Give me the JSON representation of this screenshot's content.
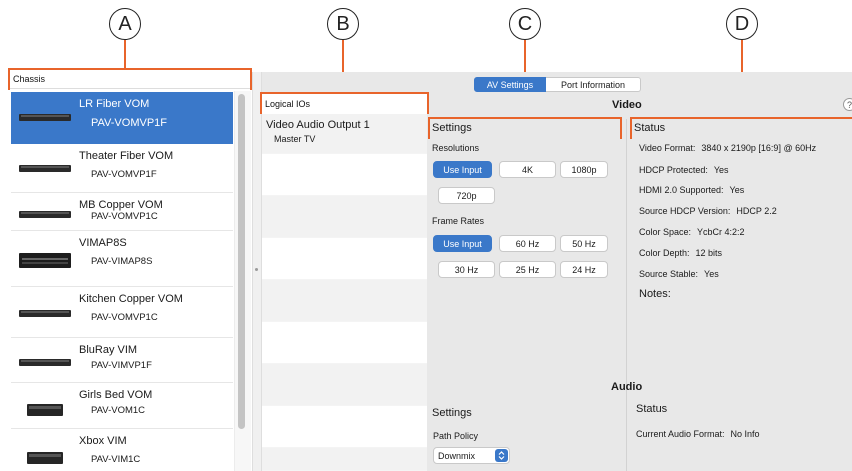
{
  "callouts": [
    "A",
    "B",
    "C",
    "D"
  ],
  "chassis": {
    "header": "Chassis",
    "items": [
      {
        "name": "LR Fiber VOM",
        "model": "PAV-VOMVP1F",
        "selected": true
      },
      {
        "name": "Theater Fiber VOM",
        "model": "PAV-VOMVP1F",
        "selected": false
      },
      {
        "name": "MB Copper VOM",
        "model": "PAV-VOMVP1C",
        "selected": false
      },
      {
        "name": "VIMAP8S",
        "model": "PAV-VIMAP8S",
        "selected": false
      },
      {
        "name": "Kitchen Copper VOM",
        "model": "PAV-VOMVP1C",
        "selected": false
      },
      {
        "name": "BluRay VIM",
        "model": "PAV-VIMVP1F",
        "selected": false
      },
      {
        "name": "Girls Bed VOM",
        "model": "PAV-VOM1C",
        "selected": false
      },
      {
        "name": "Xbox VIM",
        "model": "PAV-VIM1C",
        "selected": false
      }
    ]
  },
  "logical_ios": {
    "header": "Logical IOs",
    "items": [
      {
        "title": "Video Audio Output 1",
        "subtitle": "Master TV"
      }
    ]
  },
  "tabs": [
    {
      "label": "AV Settings",
      "active": true
    },
    {
      "label": "Port Information",
      "active": false
    }
  ],
  "video": {
    "title": "Video",
    "help_glyph": "?",
    "settings": {
      "title": "Settings",
      "resolutions_label": "Resolutions",
      "resolutions": [
        "Use Input",
        "4K",
        "1080p",
        "720p"
      ],
      "selected_resolution": "Use Input",
      "frame_rates_label": "Frame Rates",
      "frame_rates": [
        "Use Input",
        "60 Hz",
        "50 Hz",
        "30 Hz",
        "25 Hz",
        "24 Hz"
      ],
      "selected_frame_rate": "Use Input"
    },
    "status": {
      "title": "Status",
      "rows": [
        {
          "label": "Video Format:",
          "value": "3840 x 2190p [16:9] @ 60Hz"
        },
        {
          "label": "HDCP Protected:",
          "value": "Yes"
        },
        {
          "label": "HDMI 2.0 Supported:",
          "value": "Yes"
        },
        {
          "label": "Source HDCP Version:",
          "value": "HDCP 2.2"
        },
        {
          "label": "Color Space:",
          "value": "YcbCr 4:2:2"
        },
        {
          "label": "Color Depth:",
          "value": "12 bits"
        },
        {
          "label": "Source Stable:",
          "value": "Yes"
        }
      ],
      "notes_label": "Notes:"
    }
  },
  "audio": {
    "title": "Audio",
    "settings": {
      "title": "Settings",
      "path_policy_label": "Path Policy",
      "path_policy_value": "Downmix"
    },
    "status": {
      "title": "Status",
      "rows": [
        {
          "label": "Current Audio Format:",
          "value": "No Info"
        }
      ]
    }
  },
  "colors": {
    "accent": "#3a78c9",
    "callout_line": "#e8642b",
    "panel_bg": "#e8e8e8"
  }
}
